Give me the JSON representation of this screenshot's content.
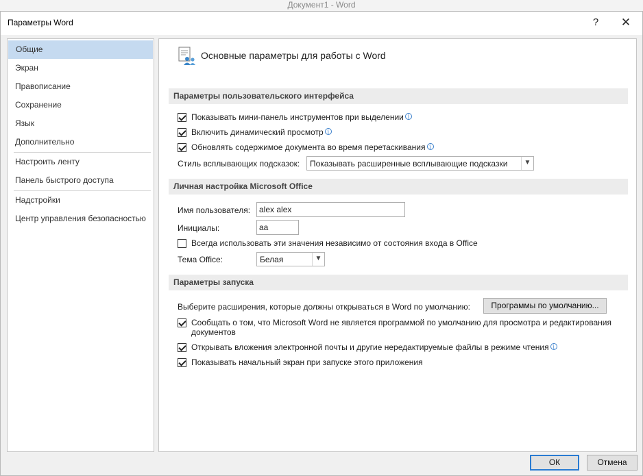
{
  "background_title": "Документ1 - Word",
  "dialog": {
    "title": "Параметры Word",
    "help_label": "?",
    "close_label": "✕"
  },
  "sidebar": {
    "items": [
      {
        "label": "Общие",
        "active": true
      },
      {
        "label": "Экран"
      },
      {
        "label": "Правописание"
      },
      {
        "label": "Сохранение"
      },
      {
        "label": "Язык"
      },
      {
        "label": "Дополнительно"
      },
      {
        "label": "Настроить ленту"
      },
      {
        "label": "Панель быстрого доступа"
      },
      {
        "label": "Надстройки"
      },
      {
        "label": "Центр управления безопасностью"
      }
    ]
  },
  "main": {
    "header": "Основные параметры для работы с Word",
    "header_icon": "general-options-icon",
    "ui_section": {
      "title": "Параметры пользовательского интерфейса",
      "options": [
        {
          "label": "Показывать мини-панель инструментов при выделении",
          "checked": true,
          "info": true
        },
        {
          "label": "Включить динамический просмотр",
          "checked": true,
          "info": true
        },
        {
          "label": "Обновлять содержимое документа во время перетаскивания",
          "checked": true,
          "info": true
        }
      ],
      "tooltip_style_label": "Стиль всплывающих подсказок:",
      "tooltip_style_value": "Показывать расширенные всплывающие подсказки"
    },
    "personal_section": {
      "title": "Личная настройка Microsoft Office",
      "username_label": "Имя пользователя:",
      "username_value": "alex alex",
      "initials_label": "Инициалы:",
      "initials_value": "aa",
      "always_use_label": "Всегда использовать эти значения независимо от состояния входа в Office",
      "always_use_checked": false,
      "theme_label": "Тема Office:",
      "theme_value": "Белая"
    },
    "startup_section": {
      "title": "Параметры запуска",
      "extensions_label": "Выберите расширения, которые должны открываться в Word по умолчанию:",
      "default_programs_button": "Программы по умолчанию...",
      "options": [
        {
          "label": "Сообщать о том, что Microsoft Word не является программой по умолчанию для просмотра и редактирования",
          "label2": "документов",
          "checked": true
        },
        {
          "label": "Открывать вложения электронной почты и другие нередактируемые файлы в режиме чтения",
          "checked": true,
          "info": true
        },
        {
          "label": "Показывать начальный экран при запуске этого приложения",
          "checked": true
        }
      ]
    }
  },
  "footer": {
    "ok_label": "ОК",
    "cancel_label": "Отмена"
  },
  "colors": {
    "selected_nav": "#c5daf0",
    "section_bg": "#ececec",
    "info_icon": "#3a7fcb",
    "primary_button_border": "#2a7bd2"
  }
}
